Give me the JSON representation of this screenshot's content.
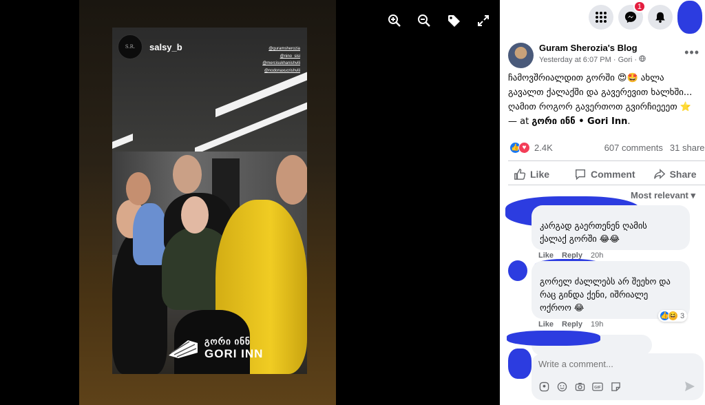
{
  "viewer": {
    "story": {
      "username": "salsy_b",
      "avatar_text": "S.R.",
      "tags": [
        "@guramsherozia",
        "@nino_sisi",
        "@mercisukhanishvili",
        "@nodonaxucrishvili"
      ],
      "logo_ka": "გორი ინნ",
      "logo_en": "GORI INN"
    },
    "tools": [
      "zoom-in-icon",
      "zoom-out-icon",
      "tag-icon",
      "fullscreen-icon"
    ]
  },
  "topbar": {
    "messenger_badge": "1"
  },
  "post": {
    "page_name": "Guram Sherozia's Blog",
    "time": "Yesterday at 6:07 PM",
    "location": "Gori",
    "text_line1": "ჩამოვშრიალდით გორში 😍🤩 ახლა",
    "text_line2": "გავალთ ქალაქში და გავერევით ხალხში...",
    "text_line3": "ღამით როგორ გავერთოთ გვირჩიეეეთ ⭐",
    "at_prefix": "— at",
    "at_place": "გორი ინნ • Gori Inn",
    "at_suffix": ".",
    "reactions_count": "2.4K",
    "comments_count": "607 comments",
    "shares_count": "31 shares",
    "action_like": "Like",
    "action_comment": "Comment",
    "action_share": "Share",
    "sort_label": "Most relevant"
  },
  "comments": [
    {
      "line1": "კარგად გაერთენენ ღამის",
      "line2": "ქალაქ გორში 😂😂",
      "like": "Like",
      "reply": "Reply",
      "time": "20h"
    },
    {
      "line1": "გორელ ძალლებს არ შეეხო და",
      "line2": "რაც გინდა ქენი, იშრიალე",
      "line3": "ოქროო 😂",
      "like": "Like",
      "reply": "Reply",
      "time": "19h",
      "reaction_count": "3"
    }
  ],
  "composer": {
    "placeholder": "Write a comment..."
  },
  "colors": {
    "fb_blue": "#1877f2",
    "redaction": "#2c3ce0",
    "gori_inn_link": "#050505"
  }
}
